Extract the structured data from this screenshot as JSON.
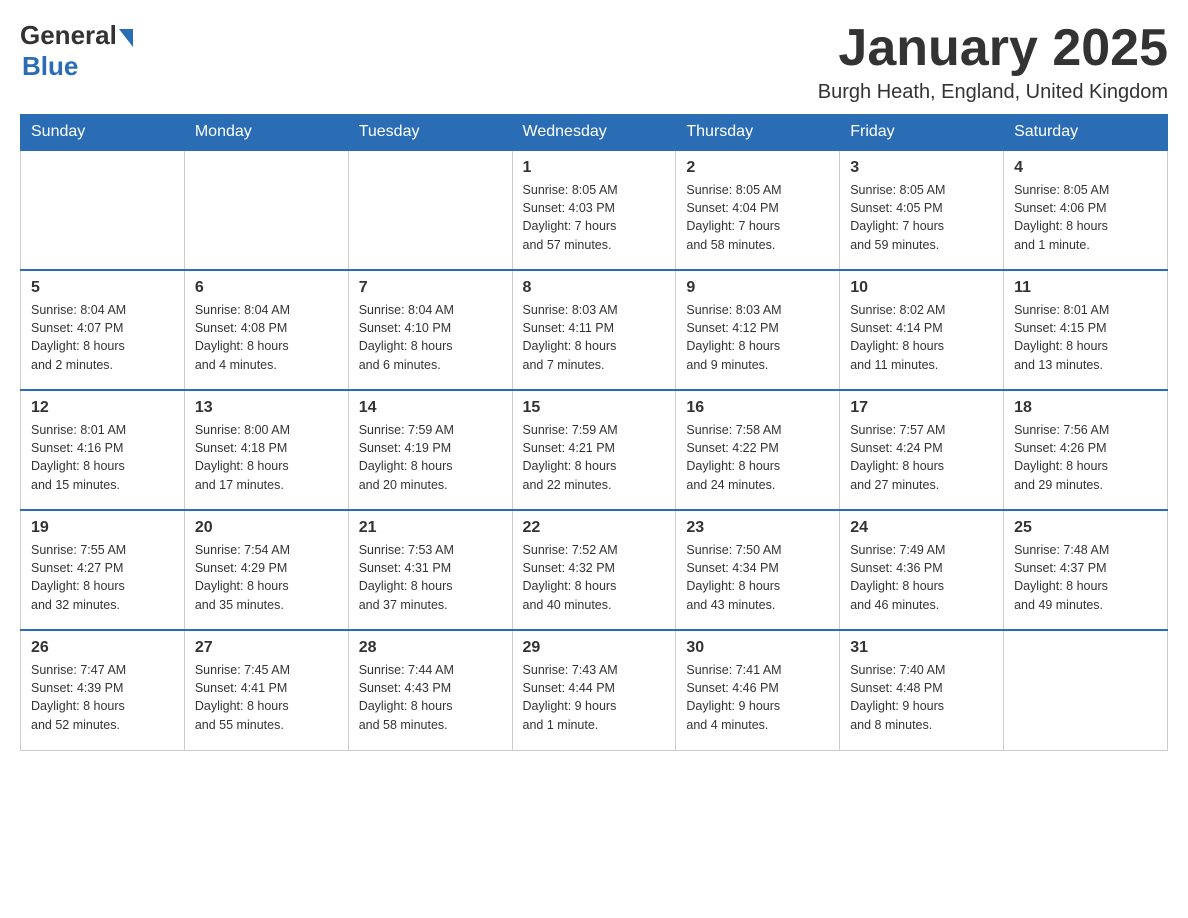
{
  "header": {
    "logo_general": "General",
    "logo_blue": "Blue",
    "month_title": "January 2025",
    "location": "Burgh Heath, England, United Kingdom"
  },
  "days_of_week": [
    "Sunday",
    "Monday",
    "Tuesday",
    "Wednesday",
    "Thursday",
    "Friday",
    "Saturday"
  ],
  "weeks": [
    [
      {
        "day": "",
        "info": ""
      },
      {
        "day": "",
        "info": ""
      },
      {
        "day": "",
        "info": ""
      },
      {
        "day": "1",
        "info": "Sunrise: 8:05 AM\nSunset: 4:03 PM\nDaylight: 7 hours\nand 57 minutes."
      },
      {
        "day": "2",
        "info": "Sunrise: 8:05 AM\nSunset: 4:04 PM\nDaylight: 7 hours\nand 58 minutes."
      },
      {
        "day": "3",
        "info": "Sunrise: 8:05 AM\nSunset: 4:05 PM\nDaylight: 7 hours\nand 59 minutes."
      },
      {
        "day": "4",
        "info": "Sunrise: 8:05 AM\nSunset: 4:06 PM\nDaylight: 8 hours\nand 1 minute."
      }
    ],
    [
      {
        "day": "5",
        "info": "Sunrise: 8:04 AM\nSunset: 4:07 PM\nDaylight: 8 hours\nand 2 minutes."
      },
      {
        "day": "6",
        "info": "Sunrise: 8:04 AM\nSunset: 4:08 PM\nDaylight: 8 hours\nand 4 minutes."
      },
      {
        "day": "7",
        "info": "Sunrise: 8:04 AM\nSunset: 4:10 PM\nDaylight: 8 hours\nand 6 minutes."
      },
      {
        "day": "8",
        "info": "Sunrise: 8:03 AM\nSunset: 4:11 PM\nDaylight: 8 hours\nand 7 minutes."
      },
      {
        "day": "9",
        "info": "Sunrise: 8:03 AM\nSunset: 4:12 PM\nDaylight: 8 hours\nand 9 minutes."
      },
      {
        "day": "10",
        "info": "Sunrise: 8:02 AM\nSunset: 4:14 PM\nDaylight: 8 hours\nand 11 minutes."
      },
      {
        "day": "11",
        "info": "Sunrise: 8:01 AM\nSunset: 4:15 PM\nDaylight: 8 hours\nand 13 minutes."
      }
    ],
    [
      {
        "day": "12",
        "info": "Sunrise: 8:01 AM\nSunset: 4:16 PM\nDaylight: 8 hours\nand 15 minutes."
      },
      {
        "day": "13",
        "info": "Sunrise: 8:00 AM\nSunset: 4:18 PM\nDaylight: 8 hours\nand 17 minutes."
      },
      {
        "day": "14",
        "info": "Sunrise: 7:59 AM\nSunset: 4:19 PM\nDaylight: 8 hours\nand 20 minutes."
      },
      {
        "day": "15",
        "info": "Sunrise: 7:59 AM\nSunset: 4:21 PM\nDaylight: 8 hours\nand 22 minutes."
      },
      {
        "day": "16",
        "info": "Sunrise: 7:58 AM\nSunset: 4:22 PM\nDaylight: 8 hours\nand 24 minutes."
      },
      {
        "day": "17",
        "info": "Sunrise: 7:57 AM\nSunset: 4:24 PM\nDaylight: 8 hours\nand 27 minutes."
      },
      {
        "day": "18",
        "info": "Sunrise: 7:56 AM\nSunset: 4:26 PM\nDaylight: 8 hours\nand 29 minutes."
      }
    ],
    [
      {
        "day": "19",
        "info": "Sunrise: 7:55 AM\nSunset: 4:27 PM\nDaylight: 8 hours\nand 32 minutes."
      },
      {
        "day": "20",
        "info": "Sunrise: 7:54 AM\nSunset: 4:29 PM\nDaylight: 8 hours\nand 35 minutes."
      },
      {
        "day": "21",
        "info": "Sunrise: 7:53 AM\nSunset: 4:31 PM\nDaylight: 8 hours\nand 37 minutes."
      },
      {
        "day": "22",
        "info": "Sunrise: 7:52 AM\nSunset: 4:32 PM\nDaylight: 8 hours\nand 40 minutes."
      },
      {
        "day": "23",
        "info": "Sunrise: 7:50 AM\nSunset: 4:34 PM\nDaylight: 8 hours\nand 43 minutes."
      },
      {
        "day": "24",
        "info": "Sunrise: 7:49 AM\nSunset: 4:36 PM\nDaylight: 8 hours\nand 46 minutes."
      },
      {
        "day": "25",
        "info": "Sunrise: 7:48 AM\nSunset: 4:37 PM\nDaylight: 8 hours\nand 49 minutes."
      }
    ],
    [
      {
        "day": "26",
        "info": "Sunrise: 7:47 AM\nSunset: 4:39 PM\nDaylight: 8 hours\nand 52 minutes."
      },
      {
        "day": "27",
        "info": "Sunrise: 7:45 AM\nSunset: 4:41 PM\nDaylight: 8 hours\nand 55 minutes."
      },
      {
        "day": "28",
        "info": "Sunrise: 7:44 AM\nSunset: 4:43 PM\nDaylight: 8 hours\nand 58 minutes."
      },
      {
        "day": "29",
        "info": "Sunrise: 7:43 AM\nSunset: 4:44 PM\nDaylight: 9 hours\nand 1 minute."
      },
      {
        "day": "30",
        "info": "Sunrise: 7:41 AM\nSunset: 4:46 PM\nDaylight: 9 hours\nand 4 minutes."
      },
      {
        "day": "31",
        "info": "Sunrise: 7:40 AM\nSunset: 4:48 PM\nDaylight: 9 hours\nand 8 minutes."
      },
      {
        "day": "",
        "info": ""
      }
    ]
  ]
}
